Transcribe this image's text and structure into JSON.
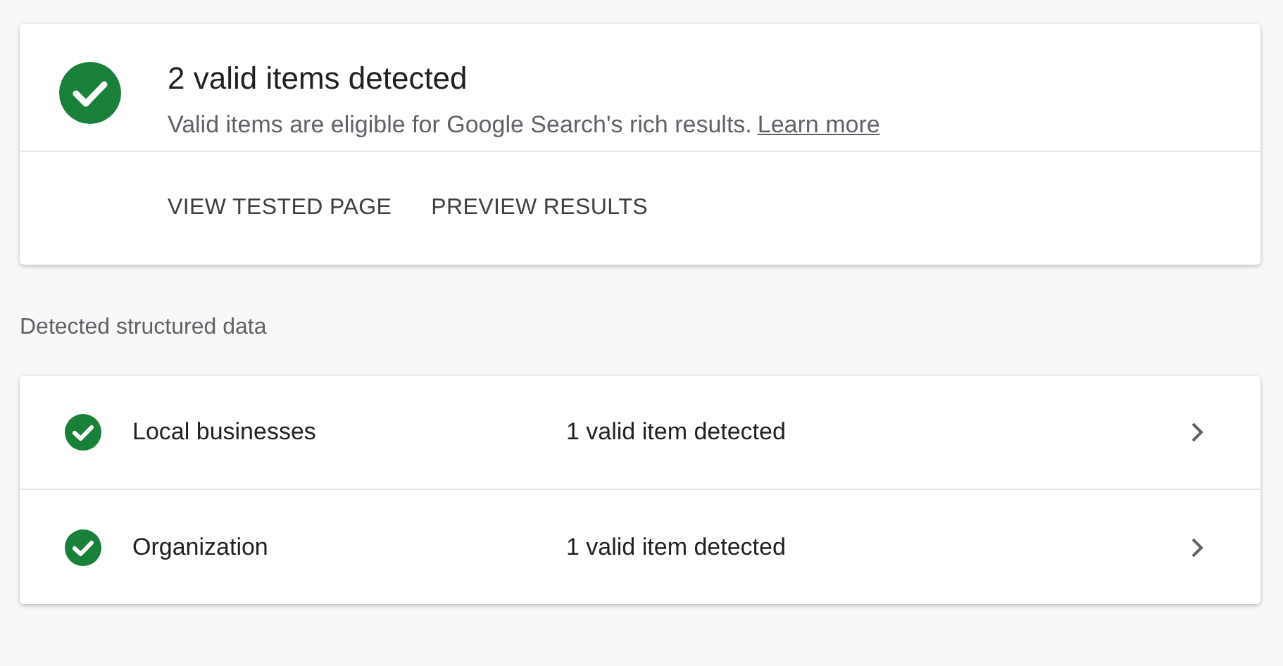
{
  "summary": {
    "title": "2 valid items detected",
    "description": "Valid items are eligible for Google Search's rich results.",
    "link": "Learn more",
    "actions": [
      "VIEW TESTED PAGE",
      "PREVIEW RESULTS"
    ]
  },
  "section_label": "Detected structured data",
  "items": [
    {
      "name": "Local businesses",
      "status": "1 valid item detected"
    },
    {
      "name": "Organization",
      "status": "1 valid item detected"
    }
  ]
}
